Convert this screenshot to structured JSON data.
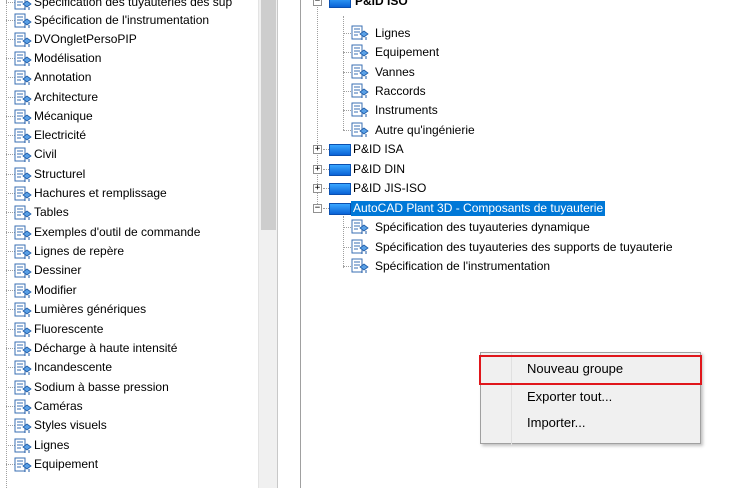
{
  "left_list": {
    "items": [
      "Spécification des tuyauteries des sup",
      "Spécification de l'instrumentation",
      "DVOngletPersoPIP",
      "Modélisation",
      "Annotation",
      "Architecture",
      "Mécanique",
      "Electricité",
      "Civil",
      "Structurel",
      "Hachures et remplissage",
      "Tables",
      "Exemples d'outil de commande",
      "Lignes de repère",
      "Dessiner",
      "Modifier",
      "Lumières génériques",
      "Fluorescente",
      "Décharge à haute intensité",
      "Incandescente",
      "Sodium à basse pression",
      "Caméras",
      "Styles visuels",
      "Lignes",
      "Equipement"
    ]
  },
  "tree": {
    "pid_iso": {
      "label": "P&ID ISO",
      "children": [
        "Lignes",
        "Equipement",
        "Vannes",
        "Raccords",
        "Instruments",
        "Autre qu'ingénierie"
      ]
    },
    "collapsed_groups": [
      "P&ID ISA",
      "P&ID DIN",
      "P&ID JIS-ISO"
    ],
    "plant3d": {
      "label": "AutoCAD Plant 3D - Composants de tuyauterie",
      "children": [
        "Spécification des tuyauteries dynamique",
        "Spécification des tuyauteries des supports de tuyauterie",
        "Spécification de l'instrumentation"
      ]
    },
    "expand_symbol": "+",
    "collapse_symbol": "−"
  },
  "context_menu": {
    "items": [
      "Nouveau groupe",
      "Exporter tout...",
      "Importer..."
    ]
  },
  "colors": {
    "selection": "#0078d7",
    "highlight_border": "#e0161b",
    "folder": "#1a7fe8"
  },
  "icons": {
    "palette_item": "palette-tool-icon",
    "group": "folder-icon"
  }
}
